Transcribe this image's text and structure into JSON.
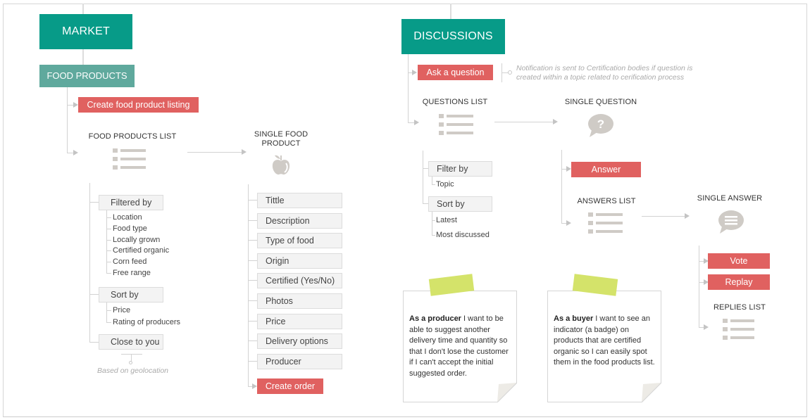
{
  "market": {
    "title": "MARKET",
    "section": "FOOD PRODUCTS",
    "create_listing": "Create food product listing",
    "food_products_list": "FOOD PRODUCTS LIST",
    "single_food_product": [
      "SINGLE FOOD",
      "PRODUCT"
    ],
    "filtered_by": "Filtered by",
    "filter_options": [
      "Location",
      "Food type",
      "Locally grown",
      "Certified organic",
      "Corn feed",
      "Free range"
    ],
    "sort_by": "Sort by",
    "sort_options": [
      "Price",
      "Rating of producers"
    ],
    "close_to_you": "Close to you",
    "geolocation_note": "Based on geolocation",
    "product_fields": [
      "Tittle",
      "Description",
      "Type of food",
      "Origin",
      "Certified (Yes/No)",
      "Photos",
      "Price",
      "Delivery options",
      "Producer"
    ],
    "create_order": "Create order"
  },
  "discussions": {
    "title": "DISCUSSIONS",
    "ask_question": "Ask a question",
    "notification_note": [
      "Notification is sent to Certification bodies if question is",
      "created within a topic related to cerification process"
    ],
    "questions_list": "QUESTIONS LIST",
    "filter_by": "Filter by",
    "filter_options": [
      "Topic"
    ],
    "sort_by": "Sort by",
    "sort_options": [
      "Latest",
      "Most discussed"
    ],
    "single_question": "SINGLE QUESTION",
    "answer": "Answer",
    "answers_list": "ANSWERS LIST",
    "single_answer": "SINGLE ANSWER",
    "vote": "Vote",
    "replay": "Replay",
    "replies_list": "REPLIES LIST"
  },
  "user_stories": [
    {
      "role": "As a producer",
      "text": " I want to be able to suggest another delivery time and quantity so that I don't lose the customer if I can't accept the initial suggested order."
    },
    {
      "role": "As a buyer",
      "text": " I want to see an indicator (a badge) on products that are certified organic so I can easily spot them in the food products list."
    }
  ],
  "colors": {
    "primary_teal": "#079b88",
    "secondary_teal": "#5fa99d",
    "action_red": "#e06160",
    "tape_green": "#d4e36a",
    "icon_gray": "#cfcbc6"
  }
}
